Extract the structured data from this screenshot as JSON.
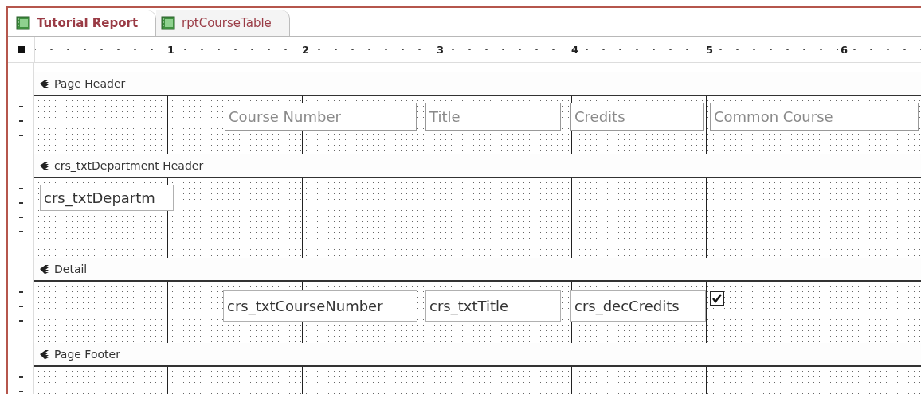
{
  "tabs": [
    {
      "label": "Tutorial Report",
      "selected": true
    },
    {
      "label": "rptCourseTable",
      "selected": false
    }
  ],
  "ruler": {
    "numbers": [
      "1",
      "2",
      "3",
      "4",
      "5",
      "6"
    ]
  },
  "sections": [
    {
      "title": "Page Header",
      "controls": [
        {
          "kind": "label",
          "text": "Course Number"
        },
        {
          "kind": "label",
          "text": "Title"
        },
        {
          "kind": "label",
          "text": "Credits"
        },
        {
          "kind": "label",
          "text": "Common Course"
        }
      ]
    },
    {
      "title": "crs_txtDepartment Header",
      "controls": [
        {
          "kind": "textbox",
          "text": "crs_txtDepartm"
        }
      ]
    },
    {
      "title": "Detail",
      "controls": [
        {
          "kind": "textbox",
          "text": "crs_txtCourseNumber"
        },
        {
          "kind": "textbox",
          "text": "crs_txtTitle"
        },
        {
          "kind": "textbox",
          "text": "crs_decCredits"
        },
        {
          "kind": "checkbox",
          "checked": true
        }
      ]
    },
    {
      "title": "Page Footer"
    }
  ]
}
